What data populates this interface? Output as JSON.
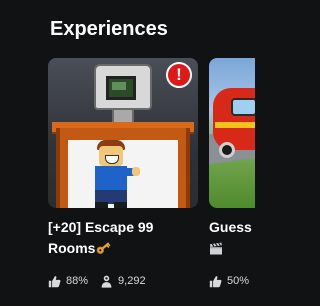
{
  "section": {
    "title": "Experiences"
  },
  "cards": [
    {
      "name": "[+20] Escape 99 Rooms",
      "name_line1": "[+20] Escape 99",
      "name_line2": "Rooms",
      "name_emoji": "key-icon",
      "badge": "!",
      "rating": "88%",
      "players": "9,292"
    },
    {
      "name": "Guess",
      "name_line1": "Guess",
      "name_emoji": "clapper-board-icon",
      "rating": "50%"
    }
  ],
  "icons": {
    "rating": "thumbs-up-icon",
    "players": "person-icon",
    "alert": "exclamation-icon"
  },
  "colors": {
    "background": "#111214",
    "text": "#ffffff",
    "stat_text": "#d8d9db",
    "alert_badge": "#e01818"
  }
}
